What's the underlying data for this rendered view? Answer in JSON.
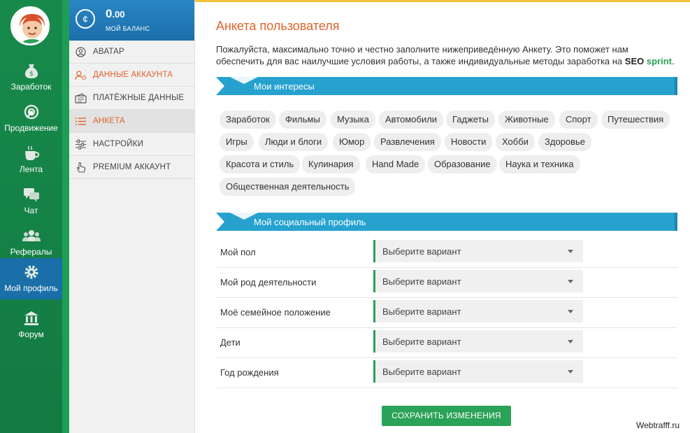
{
  "rail": {
    "items": [
      {
        "label": "Заработок",
        "icon": "money-bag-icon"
      },
      {
        "label": "Продвижение",
        "icon": "target-arrow-icon"
      },
      {
        "label": "Лента",
        "icon": "coffee-cup-icon"
      },
      {
        "label": "Чат",
        "icon": "chat-bubbles-icon"
      },
      {
        "label": "Рефералы",
        "icon": "users-icon"
      },
      {
        "label": "Мой профиль",
        "icon": "gear-icon",
        "active": true
      },
      {
        "label": "Форум",
        "icon": "building-icon"
      }
    ]
  },
  "balance": {
    "value_main": "0",
    "value_frac": ".00",
    "label": "МОЙ БАЛАНС",
    "icon": "coin-icon"
  },
  "sidebar": {
    "items": [
      {
        "label": "АВАТАР",
        "icon": "user-circle-icon"
      },
      {
        "label": "ДАННЫЕ АККАУНТА",
        "icon": "user-gear-icon"
      },
      {
        "label": "ПЛАТЁЖНЫЕ ДАННЫЕ",
        "icon": "wallet-icon"
      },
      {
        "label": "АНКЕТА",
        "icon": "list-icon",
        "active": true
      },
      {
        "label": "НАСТРОЙКИ",
        "icon": "sliders-icon"
      },
      {
        "label": "PREMIUM АККАУНТ",
        "icon": "hand-pointer-icon"
      }
    ]
  },
  "main": {
    "title": "Анкета пользователя",
    "intro_text": "Пожалуйста, максимально точно и честно заполните нижеприведённую Анкету. Это поможет нам обеспечить для вас наилучшие условия работы, а также индивидуальные методы заработка на ",
    "brand_seo": "SEO",
    "brand_sprint": "sprint",
    "intro_end": ".",
    "interests_heading": "Мои интересы",
    "interests": [
      "Заработок",
      "Фильмы",
      "Музыка",
      "Автомобили",
      "Гаджеты",
      "Животные",
      "Спорт",
      "Путешествия",
      "Игры",
      "Люди и блоги",
      "Юмор",
      "Развлечения",
      "Новости",
      "Хобби",
      "Здоровье",
      "Красота и стиль",
      "Кулинария",
      "Hand Made",
      "Образование",
      "Наука и техника",
      "Общественная деятельность"
    ],
    "social_heading": "Мой социальный профиль",
    "fields": [
      {
        "label": "Мой пол",
        "value": "Выберите вариант"
      },
      {
        "label": "Мой род деятельности",
        "value": "Выберите вариант"
      },
      {
        "label": "Моё семейное положение",
        "value": "Выберите вариант"
      },
      {
        "label": "Дети",
        "value": "Выберите вариант"
      },
      {
        "label": "Год рождения",
        "value": "Выберите вариант"
      }
    ],
    "save_label": "СОХРАНИТЬ ИЗМЕНЕНИЯ"
  },
  "watermark": "Webtrafff.ru",
  "colors": {
    "green": "#178a4b",
    "blue": "#27a2cf",
    "orange": "#e0622a",
    "accent_green": "#2aa257",
    "yellow": "#f3c13a"
  }
}
